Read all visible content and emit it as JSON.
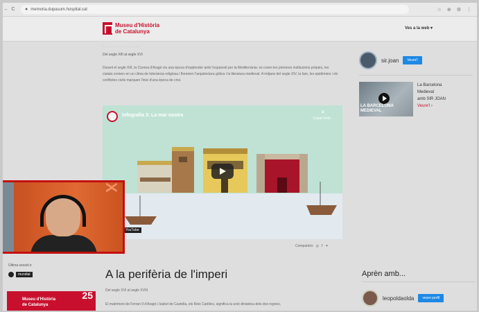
{
  "browser": {
    "url": "memoria.dupasum.hospital.cat",
    "nav": [
      "←",
      "C"
    ],
    "extensions": [
      "☆",
      "⊕",
      "⚙",
      "⋮"
    ]
  },
  "site": {
    "logo_line1": "Museu d'Història",
    "logo_line2": "de Catalunya",
    "menu_label": "Ves a la web ▾",
    "brand_color": "#c8102e"
  },
  "article": {
    "faded_heading": "...............",
    "section_sub": "Del segle XIII al segle XVI",
    "paragraph": "Durant el segle XIII, la Corona d'Aragó viu una època d'esplendor amb l'expansió per la Mediterrània: es creen les primeres institucions pròpies, les ciutats creixen en un clima de tolerància religiosa i floreixen l'arquitectura gòtica i la literatura medieval. A mitjans del segle XIV, la fam, les epidèmies i els conflictes civils marquen l'inici d'una època de crisi.",
    "video_title": "Infografia 3: La mar nostra",
    "video_share": "Copia l'enll...",
    "video_platform": "YouTube",
    "share_label": "Comparteix"
  },
  "second_section": {
    "title": "A la perifèria de l'imperi",
    "sub": "Del segle XVI al segle XVIII",
    "paragraph": "El matrimoni de Ferran II d'Aragó i Isabel de Castella, els Reis Catòlics, significa la unió dinàstica dels dos regnes,"
  },
  "sidebar": {
    "author_name": "sir.joan",
    "author_button": "Veure'l",
    "card_title_1": "La Barcelona",
    "card_title_2": "Medieval",
    "card_title_3": "amb SIR JOAN",
    "card_link": "Veure'l ›",
    "thumb_caption": "LA BARCELONA MEDIEVAL",
    "learn_heading": "Aprèn amb...",
    "author2_name": "leopoldaolda",
    "author2_button": "veure perfil"
  },
  "overlay": {
    "left_text": "Última sessió ir",
    "tag_label": "mundial",
    "mini_logo_line1": "Museu d'Història",
    "mini_logo_line2": "de Catalunya",
    "mini_logo_number": "25"
  }
}
